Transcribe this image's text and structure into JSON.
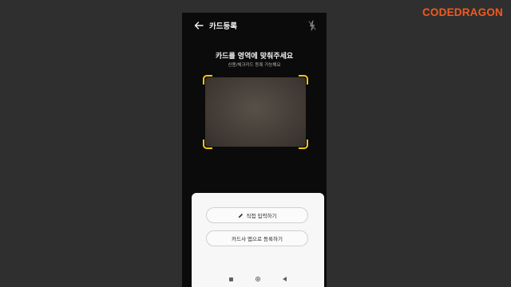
{
  "brand": {
    "text": "CODEDRAGON"
  },
  "appbar": {
    "title": "카드등록",
    "back_icon": "arrow-left",
    "flash_icon": "flash-off"
  },
  "scanner": {
    "title": "카드를 영역에 맞춰주세요",
    "subtitle": "신용/체크카드 등록 가능해요",
    "frame_color": "#f5c518"
  },
  "sheet": {
    "manual_entry_label": "직접 입력하기",
    "card_app_label": "카드사 앱으로 등록하기"
  },
  "colors": {
    "brand": "#f25a1e",
    "accent": "#f5c518",
    "background": "#2f2f2f"
  },
  "navbar": {
    "icons": [
      "recent-apps",
      "home",
      "back"
    ]
  }
}
